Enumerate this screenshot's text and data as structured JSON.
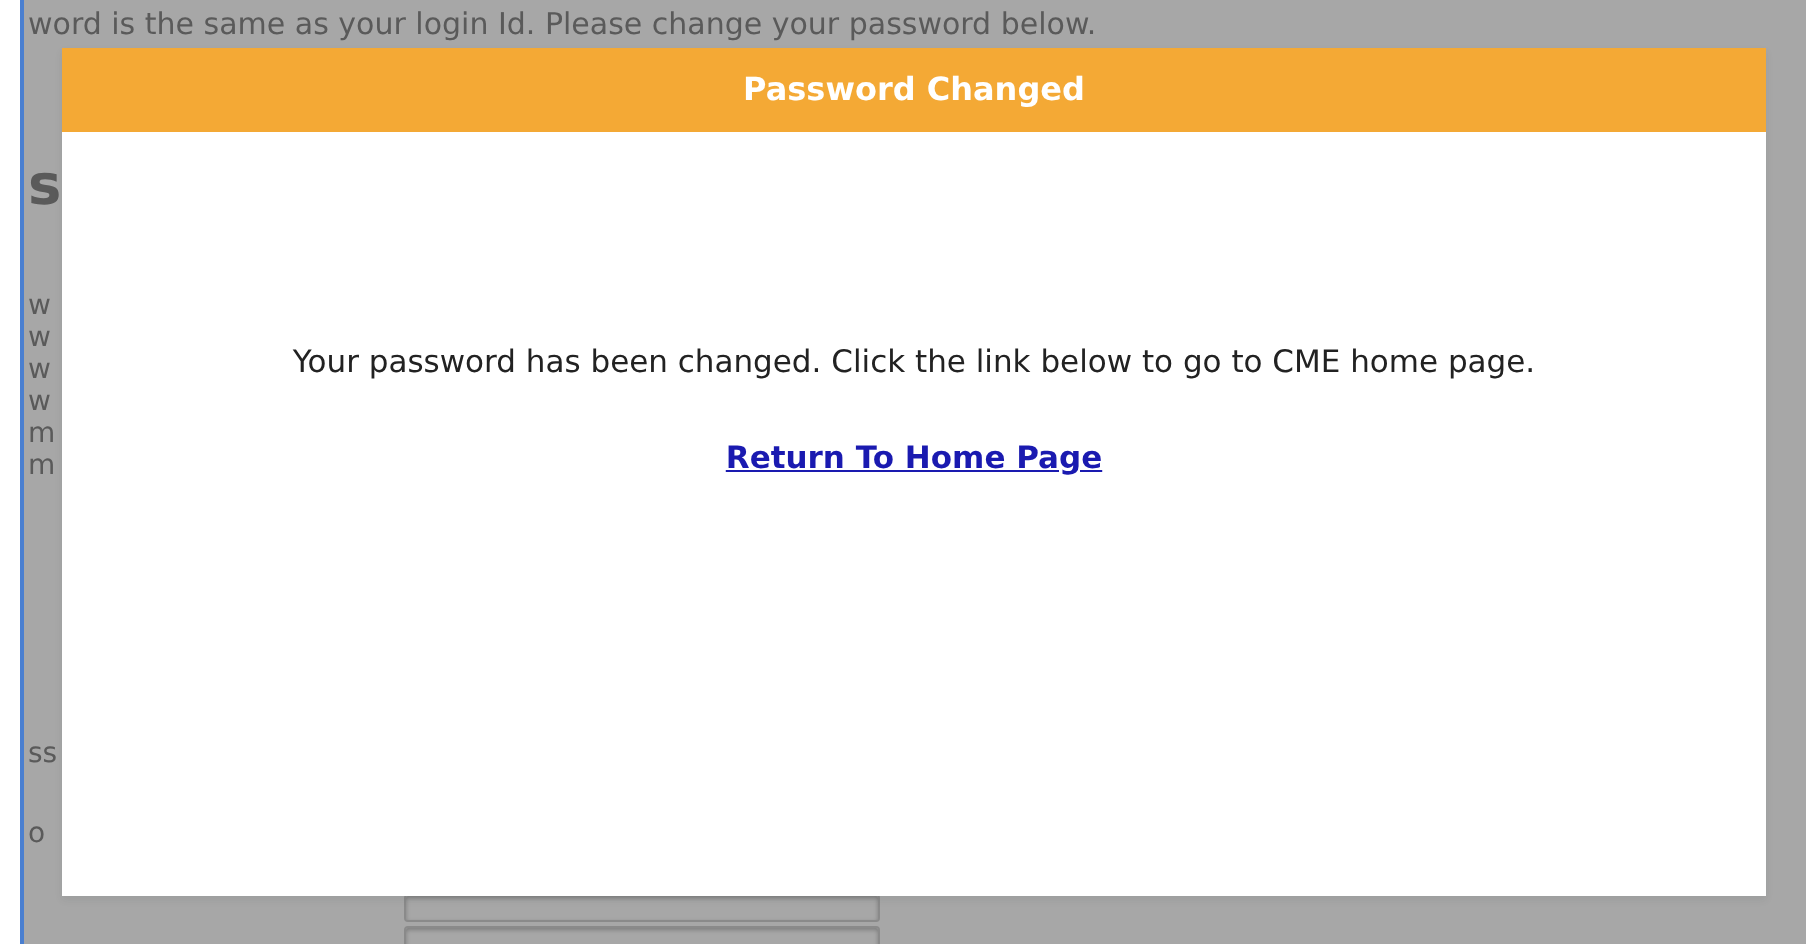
{
  "background": {
    "notice": "word is the same as your login Id. Please change your password below.",
    "heading": "s",
    "lines": [
      "w",
      "w",
      "w",
      "w",
      "m",
      "m"
    ],
    "labels": [
      "ss",
      "o"
    ],
    "inputs": [
      {
        "kind": "field"
      },
      {
        "kind": "field"
      }
    ]
  },
  "modal": {
    "title": "Password Changed",
    "message": "Your password has been changed. Click the link below to go to CME home page.",
    "link": "Return To Home Page"
  }
}
